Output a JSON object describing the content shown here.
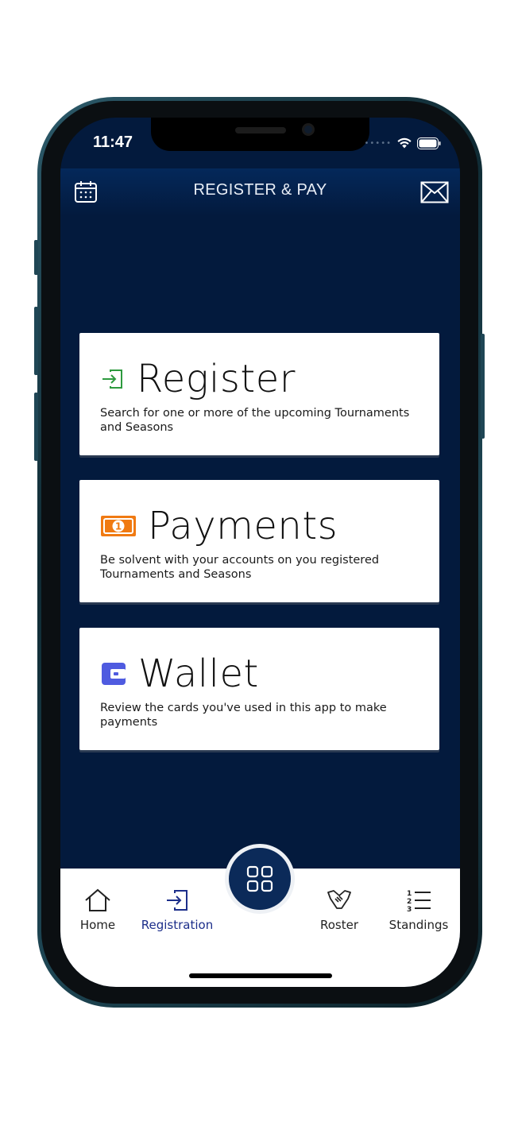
{
  "status_bar": {
    "time": "11:47"
  },
  "header": {
    "title": "REGISTER & PAY"
  },
  "cards": [
    {
      "title": "Register",
      "description": "Search for one or more of the upcoming Tournaments and Seasons",
      "icon": "sign-in-icon",
      "icon_color": "#2e9a3f"
    },
    {
      "title": "Payments",
      "description": "Be solvent with your accounts on you registered Tournaments and Seasons",
      "icon": "money-bill-icon",
      "icon_color": "#f07a12"
    },
    {
      "title": "Wallet",
      "description": "Review the cards you've used in this app to make payments",
      "icon": "wallet-icon",
      "icon_color": "#4f5be0"
    }
  ],
  "tabs": [
    {
      "label": "Home",
      "icon": "home-icon"
    },
    {
      "label": "Registration",
      "icon": "sign-in-icon",
      "active": true
    },
    {
      "label": "Roster",
      "icon": "handshake-icon"
    },
    {
      "label": "Standings",
      "icon": "numbered-list-icon"
    }
  ],
  "center_button": {
    "icon": "grid-icon"
  },
  "colors": {
    "background": "#031a3d",
    "active_tab": "#1c2e8a",
    "fab": "#0b2a59"
  }
}
